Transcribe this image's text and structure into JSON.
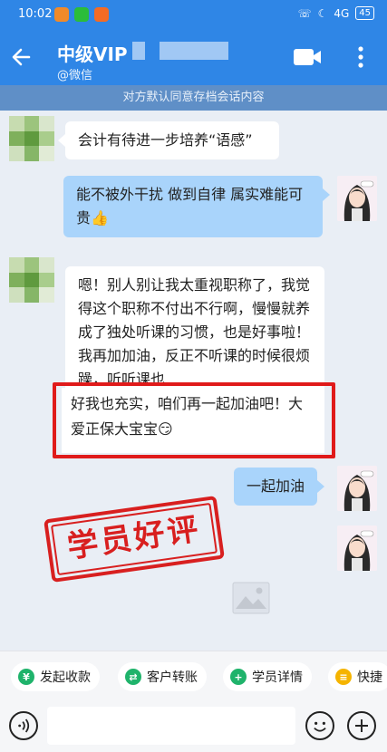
{
  "status_bar": {
    "time": "10:02",
    "signal_text": "4G",
    "battery": "45",
    "app_icons": [
      "orange-app-icon",
      "green-wechat-icon",
      "orange-square-icon"
    ]
  },
  "header": {
    "title": "中级VIP",
    "subtitle": "@微信"
  },
  "notice": "对方默认同意存档会话内容",
  "messages": [
    {
      "side": "left",
      "text": "会计有待进一步培养“语感”"
    },
    {
      "side": "right",
      "text": "能不被外干扰 做到自律 属实难能可贵",
      "emoji": "👍"
    },
    {
      "side": "left",
      "text": "嗯！别人别让我太重视职称了，我觉得这个职称不付出不行啊，慢慢就养成了独处听课的习惯，也是好事啦！我再加加油，反正不听课的时候很烦躁，听听课也"
    },
    {
      "side": "left",
      "text": "好我也充实，咱们再一起加油吧！大爱正保大宝宝",
      "emoji": "😏"
    },
    {
      "side": "right",
      "text": "一起加油"
    }
  ],
  "stamp": "学员好评",
  "quick_actions": [
    {
      "label": "发起收款",
      "icon": "yuan-icon",
      "color": "#1fb36b"
    },
    {
      "label": "客户转账",
      "icon": "transfer-icon",
      "color": "#1fb36b"
    },
    {
      "label": "学员详情",
      "icon": "user-add-icon",
      "color": "#1fb36b"
    },
    {
      "label": "快捷",
      "icon": "quick-icon",
      "color": "#f5b400"
    }
  ],
  "input": {
    "placeholder": "",
    "value": ""
  },
  "colors": {
    "header": "#2f86e6",
    "notice": "#5f8fc7",
    "bubble_right": "#a9d4fb",
    "highlight": "#e01a1a"
  }
}
